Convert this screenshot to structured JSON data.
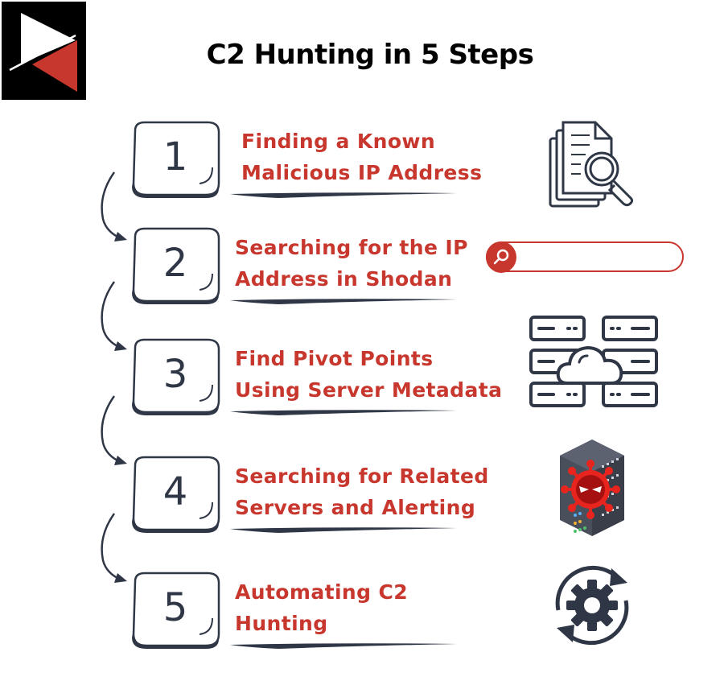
{
  "title": "C2 Hunting in 5 Steps",
  "colors": {
    "accent_red": "#c8372d",
    "ink": "#2f3747",
    "logo_bg": "#000000"
  },
  "logo": {
    "icon": "play-triangles-logo"
  },
  "steps": [
    {
      "number": "1",
      "line1": "Finding a Known",
      "line2": "Malicious IP Address",
      "icon": "document-search-icon"
    },
    {
      "number": "2",
      "line1": "Searching for the IP",
      "line2": "Address in Shodan",
      "icon": "search-bar-icon",
      "search_value": ""
    },
    {
      "number": "3",
      "line1": "Find Pivot Points",
      "line2": "Using Server Metadata",
      "icon": "cloud-server-icon"
    },
    {
      "number": "4",
      "line1": "Searching for Related",
      "line2": "Servers and Alerting",
      "icon": "infected-server-icon"
    },
    {
      "number": "5",
      "line1": "Automating C2",
      "line2": "Hunting",
      "icon": "gear-cycle-icon"
    }
  ]
}
